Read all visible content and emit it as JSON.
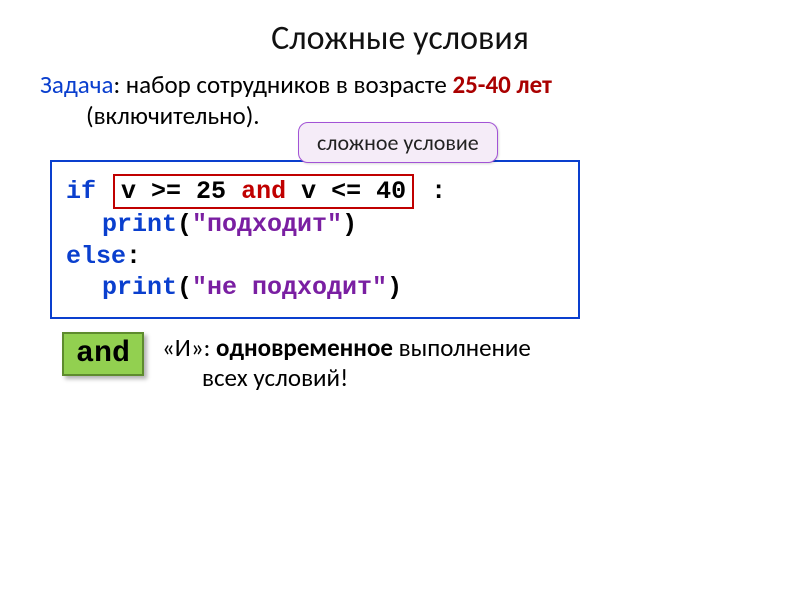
{
  "title": "Сложные условия",
  "task": {
    "label": "Задача",
    "text1": ": набор сотрудников в возрасте ",
    "age": "25-40 лет",
    "line2": "(включительно)."
  },
  "callout": "сложное условие",
  "code": {
    "if": "if",
    "cond_pre": " v >= ",
    "num1": "25",
    "and": " and ",
    "cond_mid": "v <= ",
    "num2": "40",
    "cond_post": " ",
    "colon": ":",
    "print": "print",
    "lparen": "(",
    "rparen": ")",
    "str1": "\"подходит\"",
    "else": "else",
    "else_colon": ":",
    "str2": "\"не подходит\""
  },
  "and_badge": "and",
  "and_desc": {
    "quote_and": "«И»: ",
    "bold": "одновременное",
    "rest": " выполнение",
    "line2": "всех условий!"
  }
}
